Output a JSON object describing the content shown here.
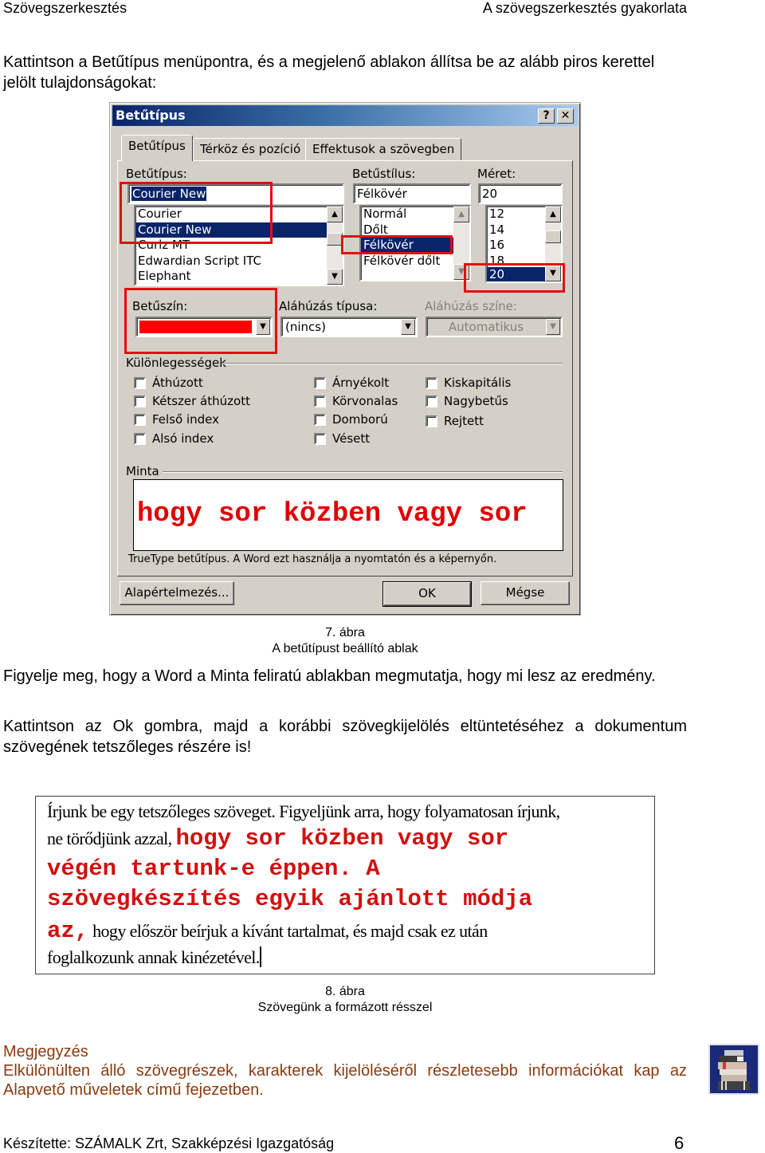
{
  "header": {
    "left": "Szövegszerkesztés",
    "right": "A szövegszerkesztés gyakorlata"
  },
  "intro": "Kattintson a Betűtípus menüpontra, és a megjelenő ablakon állítsa be az alább piros kerettel jelölt tulajdonságokat:",
  "dialog": {
    "title": "Betűtípus",
    "help_button": "?",
    "close_button": "✕",
    "tabs": [
      {
        "label": "Betűtípus",
        "active": true
      },
      {
        "label": "Térköz és pozíció",
        "active": false
      },
      {
        "label": "Effektusok a szövegben",
        "active": false
      }
    ],
    "font": {
      "label": "Betűtípus:",
      "value": "Courier New",
      "options": [
        "Courier",
        "Courier New",
        "Curlz MT",
        "Edwardian Script ITC",
        "Elephant"
      ],
      "selected": "Courier New"
    },
    "style": {
      "label": "Betűstílus:",
      "value": "Félkövér",
      "options": [
        "Normál",
        "Dőlt",
        "Félkövér",
        "Félkövér dőlt"
      ],
      "selected": "Félkövér"
    },
    "size": {
      "label": "Méret:",
      "value": "20",
      "options": [
        "12",
        "14",
        "16",
        "18",
        "20"
      ],
      "selected": "20"
    },
    "font_color": {
      "label": "Betűszín:",
      "value_color": "#ff0000"
    },
    "underline_type": {
      "label": "Aláhúzás típusa:",
      "value": "(nincs)"
    },
    "underline_color": {
      "label": "Aláhúzás színe:",
      "value": "Automatikus",
      "disabled": true
    },
    "effects": {
      "label": "Különlegességek",
      "items": [
        {
          "label": "Áthúzott",
          "checked": false
        },
        {
          "label": "Kétszer áthúzott",
          "checked": false
        },
        {
          "label": "Felső index",
          "checked": false
        },
        {
          "label": "Alsó index",
          "checked": false
        },
        {
          "label": "Árnyékolt",
          "checked": false
        },
        {
          "label": "Körvonalas",
          "checked": false
        },
        {
          "label": "Domború",
          "checked": false
        },
        {
          "label": "Vésett",
          "checked": false
        },
        {
          "label": "Kiskapitális",
          "checked": false
        },
        {
          "label": "Nagybetűs",
          "checked": false
        },
        {
          "label": "Rejtett",
          "checked": false
        }
      ]
    },
    "preview": {
      "label": "Minta",
      "text": "hogy sor közben vagy sor",
      "color": "#e00000",
      "note": "TrueType betűtípus. A Word ezt használja a nyomtatón és a képernyőn."
    },
    "buttons": {
      "default": "Alapértelmezés...",
      "ok": "OK",
      "cancel": "Mégse"
    },
    "highlight_color": "#e01010"
  },
  "figure7": {
    "number": "7. ábra",
    "caption": "A betűtípust beállító ablak"
  },
  "para1": "Figyelje meg, hogy a Word a Minta feliratú ablakban megmutatja, hogy mi lesz az eredmény.",
  "para2": "Kattintson az Ok gombra, majd a korábbi szövegkijelölés eltüntetéséhez a dokumentum szövegének tetszőleges részére is!",
  "document_sample": {
    "line1": "Írjunk be egy tetszőleges szöveget. Figyeljünk arra, hogy folyamatosan írjunk,",
    "line2_plain": "ne törődjünk azzal,",
    "line2_red": "hogy sor közben vagy sor",
    "line3_red": "végén tartunk-e éppen. A",
    "line4_red": "szövegkészítés egyik ajánlott módja",
    "line5_red": "az,",
    "line5_plain": "hogy először beírjuk a kívánt tartalmat, és majd csak ez után",
    "line6": "foglalkozunk annak kinézetével."
  },
  "figure8": {
    "number": "8. ábra",
    "caption": "Szövegünk a formázott résszel"
  },
  "note": {
    "title": "Megjegyzés",
    "text": "Elkülönülten álló szövegrészek, karakterek kijelöléséről részletesebb információkat kap az Alapvető műveletek című fejezetben.",
    "icon": "books-icon",
    "color": "#8b3a0e"
  },
  "footer": {
    "left": "Készítette: SZÁMALK Zrt, Szakképzési Igazgatóság",
    "page": "6"
  }
}
